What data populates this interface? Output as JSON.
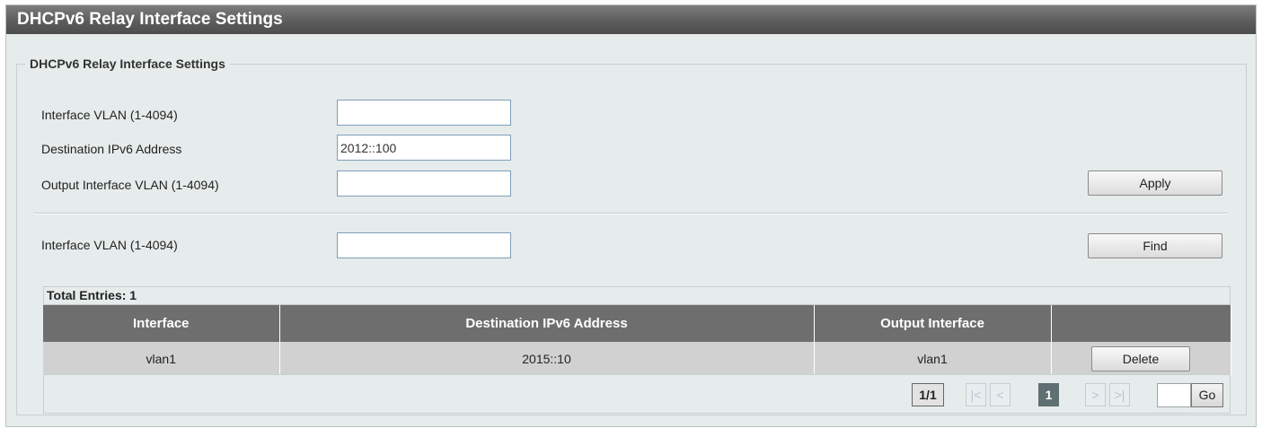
{
  "page_title": "DHCPv6 Relay Interface Settings",
  "section_legend": "DHCPv6 Relay Interface Settings",
  "form": {
    "interface_vlan_label": "Interface VLAN (1-4094)",
    "interface_vlan_value": "",
    "destination_label": "Destination IPv6 Address",
    "destination_value": "2012::100",
    "output_vlan_label": "Output Interface VLAN (1-4094)",
    "output_vlan_value": "",
    "apply_label": "Apply"
  },
  "find": {
    "interface_vlan_label": "Interface VLAN (1-4094)",
    "interface_vlan_value": "",
    "find_label": "Find"
  },
  "table": {
    "total_entries": "Total Entries: 1",
    "columns": [
      "Interface",
      "Destination IPv6 Address",
      "Output Interface",
      ""
    ],
    "rows": [
      {
        "interface": "vlan1",
        "destination": "2015::10",
        "output": "vlan1",
        "action": "Delete"
      }
    ]
  },
  "pagination": {
    "count": "1/1",
    "first": "|<",
    "prev": "<",
    "current": "1",
    "next": ">",
    "last": ">|",
    "go_label": "Go",
    "go_value": ""
  },
  "colors": {
    "title_bar": "#5d5d5d",
    "panel_bg": "#e6eceb",
    "table_header": "#6e6e6e",
    "row_bg": "#d1d1d1"
  }
}
